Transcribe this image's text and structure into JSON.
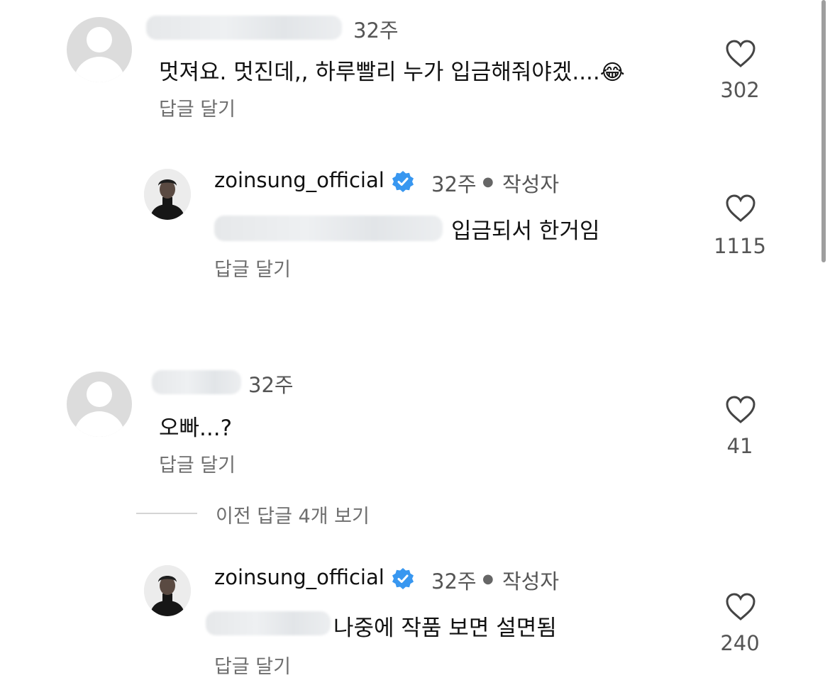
{
  "comments": [
    {
      "time": "32주",
      "text": "멋져요. 멋진데,, 하루빨리 누가 입금해줘야겠....",
      "emoji": "😂",
      "reply_label": "답글 달기",
      "likes": "302"
    },
    {
      "username": "zoinsung_official",
      "time": "32주",
      "author_tag": "작성자",
      "text": "입금되서 한거임",
      "reply_label": "답글 달기",
      "likes": "1115"
    },
    {
      "time": "32주",
      "text": "오빠...?",
      "reply_label": "답글 달기",
      "likes": "41"
    },
    {
      "username": "zoinsung_official",
      "time": "32주",
      "author_tag": "작성자",
      "text": "나중에 작품 보면 설면됨",
      "reply_label": "답글 달기",
      "likes": "240"
    }
  ],
  "view_previous": "이전 답글 4개 보기",
  "colors": {
    "verified": "#3897f0",
    "text": "#111111",
    "muted": "#6e6e6e",
    "avatar_bg": "#dcdcdc"
  },
  "icons": {
    "like": "heart-icon",
    "verified": "verified-badge-icon",
    "default_avatar": "default-avatar-icon"
  }
}
